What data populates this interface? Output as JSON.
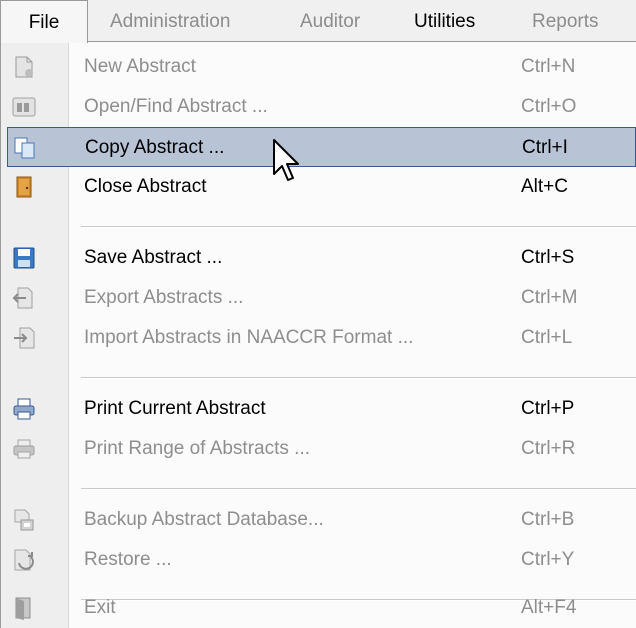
{
  "menubar": {
    "file": "File",
    "administration": "Administration",
    "auditor": "Auditor",
    "utilities": "Utilities",
    "reports": "Reports"
  },
  "file_menu": {
    "items": [
      {
        "label": "New Abstract",
        "shortcut": "Ctrl+N",
        "enabled": false,
        "icon": "new-document-icon"
      },
      {
        "label": "Open/Find Abstract ...",
        "shortcut": "Ctrl+O",
        "enabled": false,
        "icon": "binoculars-icon"
      },
      {
        "label": "Copy Abstract ...",
        "shortcut": "Ctrl+I",
        "enabled": true,
        "highlighted": true,
        "icon": "copy-icon"
      },
      {
        "label": "Close Abstract",
        "shortcut": "Alt+C",
        "enabled": true,
        "icon": "door-icon"
      },
      {
        "label": "Save Abstract ...",
        "shortcut": "Ctrl+S",
        "enabled": true,
        "icon": "floppy-disk-icon"
      },
      {
        "label": "Export Abstracts ...",
        "shortcut": "Ctrl+M",
        "enabled": false,
        "icon": "export-icon"
      },
      {
        "label": "Import Abstracts in NAACCR Format ...",
        "shortcut": "Ctrl+L",
        "enabled": false,
        "icon": "import-icon"
      },
      {
        "label": "Print Current Abstract",
        "shortcut": "Ctrl+P",
        "enabled": true,
        "icon": "printer-icon"
      },
      {
        "label": "Print Range of Abstracts ...",
        "shortcut": "Ctrl+R",
        "enabled": false,
        "icon": "printer-range-icon"
      },
      {
        "label": "Backup Abstract Database...",
        "shortcut": "Ctrl+B",
        "enabled": false,
        "icon": "backup-icon"
      },
      {
        "label": "Restore ...",
        "shortcut": "Ctrl+Y",
        "enabled": false,
        "icon": "restore-icon"
      },
      {
        "label": "Exit",
        "shortcut": "Alt+F4",
        "enabled": false,
        "icon": "exit-icon"
      }
    ]
  },
  "colors": {
    "highlight_bg": "#b8c3d6",
    "highlight_border": "#3b5a92",
    "disabled_text": "#8e8e8e"
  }
}
